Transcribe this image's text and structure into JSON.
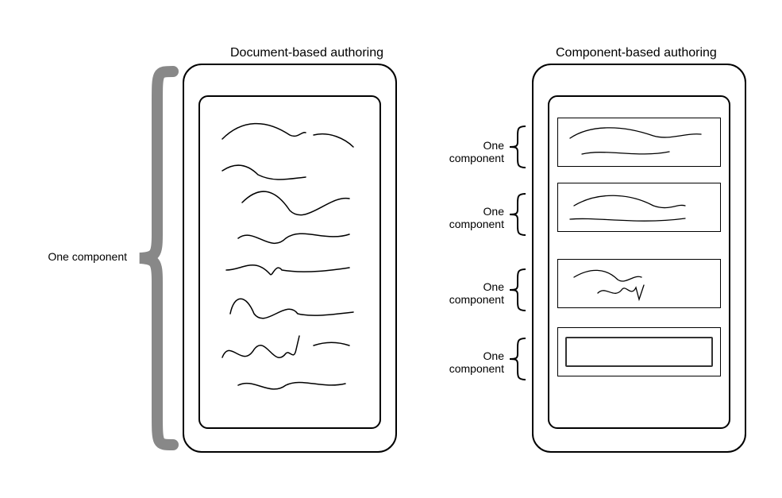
{
  "titles": {
    "left": "Document-based authoring",
    "right": "Component-based authoring"
  },
  "labels": {
    "big": "One component",
    "c1": "One component",
    "c2": "One component",
    "c3": "One component",
    "c4": "One component"
  }
}
